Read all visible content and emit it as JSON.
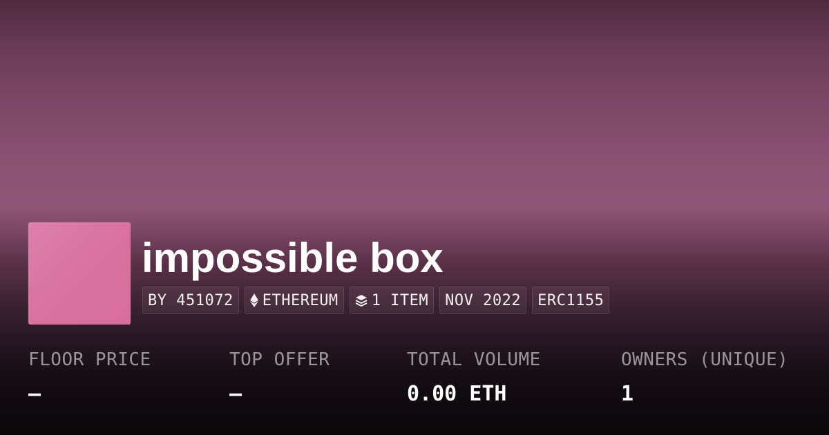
{
  "collection": {
    "name": "impossible box",
    "thumbnail_color": "#d9729f"
  },
  "tags": {
    "creator": "BY 451072",
    "chain": "ETHEREUM",
    "chain_icon": "ethereum-icon",
    "items": "1 ITEM",
    "items_icon": "layers-icon",
    "date": "NOV 2022",
    "standard": "ERC1155"
  },
  "stats": {
    "floor_price": {
      "label": "FLOOR PRICE",
      "value": "—"
    },
    "top_offer": {
      "label": "TOP OFFER",
      "value": "—"
    },
    "total_volume": {
      "label": "TOTAL VOLUME",
      "value": "0.00 ETH"
    },
    "owners": {
      "label": "OWNERS (UNIQUE)",
      "value": "1"
    }
  }
}
